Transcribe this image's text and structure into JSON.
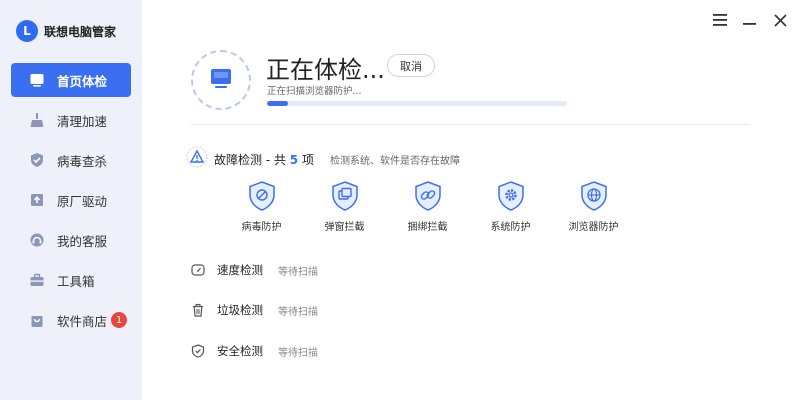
{
  "brand": {
    "logo_letter": "L",
    "name": "联想电脑管家",
    "color": "#2f6cf6"
  },
  "sidebar": {
    "items": [
      {
        "label": "首页体检",
        "icon": "monitor-icon",
        "active": true
      },
      {
        "label": "清理加速",
        "icon": "broom-icon"
      },
      {
        "label": "病毒查杀",
        "icon": "shield-check-icon"
      },
      {
        "label": "原厂驱动",
        "icon": "driver-box-icon"
      },
      {
        "label": "我的客服",
        "icon": "headset-icon"
      },
      {
        "label": "工具箱",
        "icon": "toolbox-icon"
      },
      {
        "label": "软件商店",
        "icon": "store-bag-icon",
        "badge": "1"
      }
    ]
  },
  "window_controls": {
    "menu": "menu-icon",
    "minimize": "minimize-icon",
    "close": "close-icon"
  },
  "scan": {
    "title": "正在体检...",
    "cancel_label": "取消",
    "status": "正在扫描浏览器防护...",
    "progress_fraction": 0.07
  },
  "fault": {
    "title_prefix": "故障检测 - 共 ",
    "count": "5",
    "title_suffix": " 项",
    "description": "检测系统、软件是否存在故障",
    "items": [
      {
        "label": "病毒防护",
        "icon": "virus-shield-icon"
      },
      {
        "label": "弹窗拦截",
        "icon": "popup-shield-icon"
      },
      {
        "label": "捆绑拦截",
        "icon": "link-shield-icon"
      },
      {
        "label": "系统防护",
        "icon": "gear-shield-icon"
      },
      {
        "label": "浏览器防护",
        "icon": "globe-shield-icon"
      }
    ]
  },
  "tasks": [
    {
      "name": "速度检测",
      "status": "等待扫描",
      "icon": "speedometer-icon"
    },
    {
      "name": "垃圾检测",
      "status": "等待扫描",
      "icon": "trash-icon"
    },
    {
      "name": "安全检测",
      "status": "等待扫描",
      "icon": "shield-icon"
    }
  ],
  "colors": {
    "accent": "#3a6ff2",
    "sidebar_bg": "#eef1fa",
    "badge": "#e8453c"
  }
}
